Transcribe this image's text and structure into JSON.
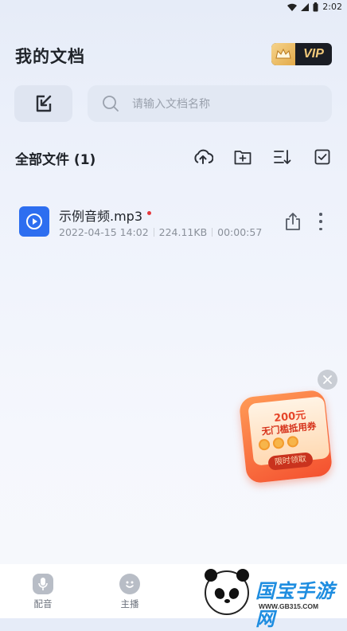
{
  "status_bar": {
    "time": "2:02"
  },
  "header": {
    "title": "我的文档",
    "vip_label": "VIP"
  },
  "search": {
    "placeholder": "请输入文档名称"
  },
  "section": {
    "title": "全部文件 (1)"
  },
  "files": [
    {
      "name": "示例音频.mp3",
      "date": "2022-04-15 14:02",
      "size": "224.11KB",
      "duration": "00:00:57"
    }
  ],
  "promo": {
    "amount": "200元",
    "description": "无门槛抵用券",
    "cta": "限时领取"
  },
  "bottom_nav": [
    {
      "label": "配音",
      "icon": "mic-icon"
    },
    {
      "label": "主播",
      "icon": "face-icon"
    }
  ],
  "watermark": {
    "title": "国宝手游网",
    "url": "WWW.GB315.COM"
  },
  "colors": {
    "accent": "#2d6ef0",
    "vip_gold": "#f1c97a",
    "promo_red": "#f4502f",
    "new_dot": "#e5383b"
  }
}
